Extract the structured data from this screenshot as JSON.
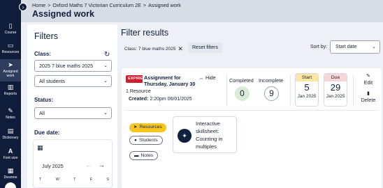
{
  "sidebar": {
    "toggle_icon": "chevron-right-icon",
    "items": [
      {
        "label": "Course",
        "icon": "book-icon",
        "glyph": "▯"
      },
      {
        "label": "Resources",
        "icon": "folder-icon",
        "glyph": "▭"
      },
      {
        "label": "Assigned work",
        "icon": "paper-plane-icon",
        "glyph": "➤"
      },
      {
        "label": "Reports",
        "icon": "bar-chart-icon",
        "glyph": "▥"
      },
      {
        "label": "Notes",
        "icon": "pencil-icon",
        "glyph": "✎"
      },
      {
        "label": "Dictionary",
        "icon": "dictionary-icon",
        "glyph": "▤"
      },
      {
        "label": "Font size",
        "icon": "font-size-icon",
        "glyph": "A"
      },
      {
        "label": "Desmos",
        "icon": "desmos-icon",
        "glyph": "▦"
      }
    ]
  },
  "header": {
    "breadcrumbs": [
      "Home",
      "Oxford Maths 7 Victorian Curriculum 2E",
      "Assigned work"
    ],
    "separator": ">",
    "title": "Assigned work"
  },
  "filters": {
    "title": "Filters",
    "class_label": "Class:",
    "class_value": "2025 7 blue maths 2025",
    "students_value": "All students",
    "status_label": "Status:",
    "status_value": "All",
    "due_date_label": "Due date:",
    "calendar": {
      "month": "July 2025",
      "weekdays": [
        "T",
        "W",
        "T",
        "F",
        "S"
      ]
    }
  },
  "results": {
    "title": "Filter results",
    "chip": "Class: 7 blue maths 2025",
    "reset_label": "Reset filters",
    "sort_label": "Sort by:",
    "sort_value": "Start date"
  },
  "assignment": {
    "badge": "EXPIRED",
    "title": "Assignment for Thursday, January 30",
    "hide_label": "Hide",
    "resource_count": "1 Resource",
    "created_label": "Created:",
    "created_value": "2:20pm 06/01/2025",
    "completed_label": "Completed",
    "completed_count": "0",
    "incomplete_label": "Incomplete",
    "incomplete_count": "9",
    "start": {
      "label": "Start",
      "day": "5",
      "month_year": "Jan 2025"
    },
    "due": {
      "label": "Due",
      "day": "29",
      "month_year": "Jan 2025"
    },
    "edit_label": "Edit",
    "delete_label": "Delete",
    "resources_label": "Resources",
    "students_label": "Students",
    "notes_label": "Notes",
    "resource_item": "Interactive skillsheet: Counting in multiples"
  },
  "colors": {
    "sidebar": "#0f1c3a",
    "expired": "#c8202f",
    "resources_pill": "#f7c623",
    "start_header": "#fbe6a6",
    "due_header": "#f8d6da",
    "completed_circle": "#d7ebd5"
  }
}
